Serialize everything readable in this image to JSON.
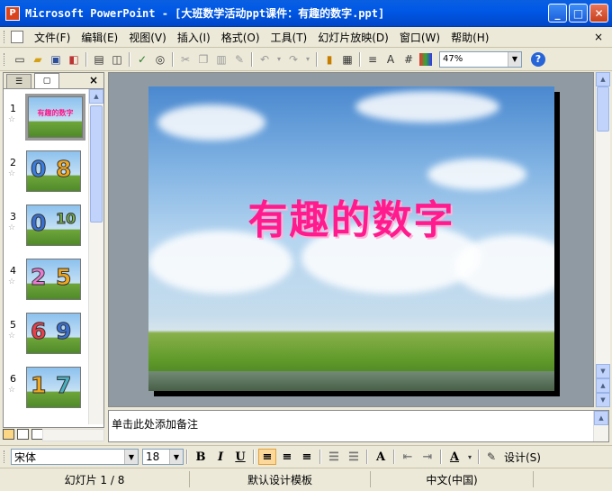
{
  "window": {
    "app_icon": "P",
    "title": "Microsoft PowerPoint - [大班数学活动ppt课件：有趣的数字.ppt]"
  },
  "menu": {
    "items": [
      "文件(F)",
      "编辑(E)",
      "视图(V)",
      "插入(I)",
      "格式(O)",
      "工具(T)",
      "幻灯片放映(D)",
      "窗口(W)",
      "帮助(H)"
    ],
    "close_symbol": "×"
  },
  "toolbar": {
    "icons": [
      "new-icon",
      "open-icon",
      "save-icon",
      "permission-icon",
      "print-icon",
      "print-preview-icon",
      "spelling-icon",
      "research-icon",
      "cut-icon",
      "copy-icon",
      "paste-icon",
      "format-painter-icon",
      "undo-icon",
      "redo-icon",
      "insert-chart-icon",
      "insert-table-icon",
      "expand-icon",
      "show-formatting-icon",
      "grid-icon",
      "color-grayscale-icon"
    ],
    "zoom": "47%"
  },
  "left_pane": {
    "tabs": [
      "outline-tab",
      "slides-tab"
    ],
    "close_symbol": "×",
    "slides": [
      {
        "number": "1",
        "title": "有趣的数字",
        "digits": []
      },
      {
        "number": "2",
        "digits": [
          "0",
          "8"
        ],
        "colors": [
          "#3a7de0",
          "#f2a81d"
        ]
      },
      {
        "number": "3",
        "digits": [
          "0",
          "10"
        ],
        "colors": [
          "#3a6fd0",
          "#7ab64a"
        ]
      },
      {
        "number": "4",
        "digits": [
          "2",
          "5"
        ],
        "colors": [
          "#e87bd0",
          "#f2a81d"
        ]
      },
      {
        "number": "5",
        "digits": [
          "6",
          "9"
        ],
        "colors": [
          "#e6404a",
          "#3a6fd0"
        ]
      },
      {
        "number": "6",
        "digits": [
          "1",
          "7"
        ],
        "colors": [
          "#f2a81d",
          "#4ab0c0"
        ]
      }
    ]
  },
  "slide": {
    "title": "有趣的数字",
    "title_color": "#ff1b8d"
  },
  "notes": {
    "placeholder": "单击此处添加备注"
  },
  "format_bar": {
    "font": "宋体",
    "size": "18",
    "bold": "B",
    "italic": "I",
    "underline": "U",
    "design": "设计(S)"
  },
  "status": {
    "slide": "幻灯片 1 / 8",
    "template": "默认设计模板",
    "language": "中文(中国)"
  }
}
